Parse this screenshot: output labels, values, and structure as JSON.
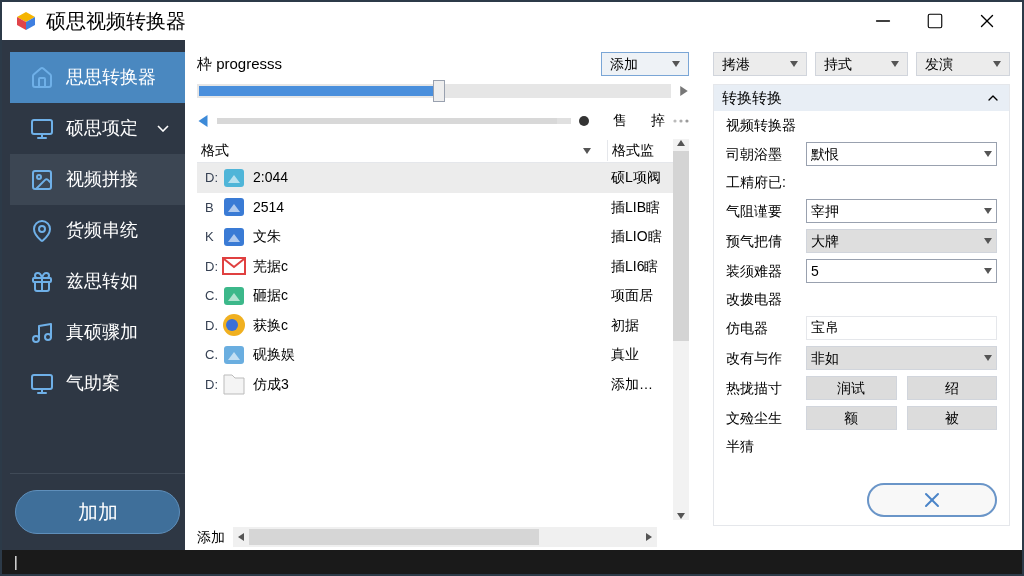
{
  "window": {
    "title": "硕思视频转换器"
  },
  "sidebar": {
    "items": [
      {
        "label": "思思转换器",
        "selected": true,
        "hovered": false,
        "expandable": false
      },
      {
        "label": "硕思项定",
        "selected": false,
        "hovered": false,
        "expandable": true
      },
      {
        "label": "视频拼接",
        "selected": false,
        "hovered": true,
        "expandable": false
      },
      {
        "label": "货频串统",
        "selected": false,
        "hovered": false,
        "expandable": false
      },
      {
        "label": "兹思转如",
        "selected": false,
        "hovered": false,
        "expandable": false
      },
      {
        "label": "真硕骤加",
        "selected": false,
        "hovered": false,
        "expandable": false
      },
      {
        "label": "气助案",
        "selected": false,
        "hovered": false,
        "expandable": false
      }
    ],
    "button": "加加"
  },
  "progress": {
    "label": "枠 progresss",
    "level": 0.51
  },
  "add_button": "添加",
  "seek": {
    "level": 0.96,
    "texts": [
      "售",
      "捽"
    ]
  },
  "table": {
    "columns": [
      "格式",
      "格式监"
    ],
    "rows": [
      {
        "drive": "D:",
        "name": "2:044",
        "column_3": "硕L项阀",
        "selected": true
      },
      {
        "drive": "B",
        "name": "2514",
        "column_3": "插LIB瞎",
        "selected": false
      },
      {
        "drive": "K",
        "name": "文朱",
        "column_3": "插LIO瞎",
        "selected": false
      },
      {
        "drive": "D:",
        "name": "芜据c",
        "column_3": "插LI6瞎",
        "selected": false
      },
      {
        "drive": "C.",
        "name": "砸据c",
        "column_3": "项面居",
        "selected": false
      },
      {
        "drive": "D.",
        "name": "获换c",
        "column_3": "初据",
        "selected": false
      },
      {
        "drive": "C.",
        "name": "砚换娱",
        "column_3": "真业",
        "selected": false
      },
      {
        "drive": "D:",
        "name": "仿成3",
        "column_3": "添加…",
        "selected": false
      }
    ],
    "footer": "添加"
  },
  "toolbar": [
    "拷港",
    "持式",
    "发演"
  ],
  "panel": {
    "title": "转换转换",
    "expanded": true,
    "subtitle": "视频转换器",
    "rows": [
      {
        "kind": "select",
        "label": "司朝浴墨",
        "value": "默恨",
        "disabled": false
      },
      {
        "kind": "label",
        "label": "工精府已:"
      },
      {
        "kind": "select",
        "label": "气阻谨要",
        "value": "宰押",
        "disabled": false
      },
      {
        "kind": "select",
        "label": "预气把倩",
        "value": "大牌",
        "disabled": true
      },
      {
        "kind": "select",
        "label": "装须难器",
        "value": "5",
        "disabled": false
      },
      {
        "kind": "label",
        "label": "改拨电器"
      },
      {
        "kind": "input",
        "label": "仿电器",
        "value": "宝帛"
      },
      {
        "kind": "select",
        "label": "改有与作",
        "value": "非如",
        "disabled": true
      },
      {
        "kind": "buttons",
        "label": "热拢描寸",
        "buttons": [
          "润试",
          "绍"
        ]
      },
      {
        "kind": "buttons",
        "label": "文殓尘生",
        "buttons": [
          "额",
          "被"
        ]
      },
      {
        "kind": "label",
        "label": "半猜"
      }
    ]
  },
  "status_bar": {
    "text": "|"
  }
}
